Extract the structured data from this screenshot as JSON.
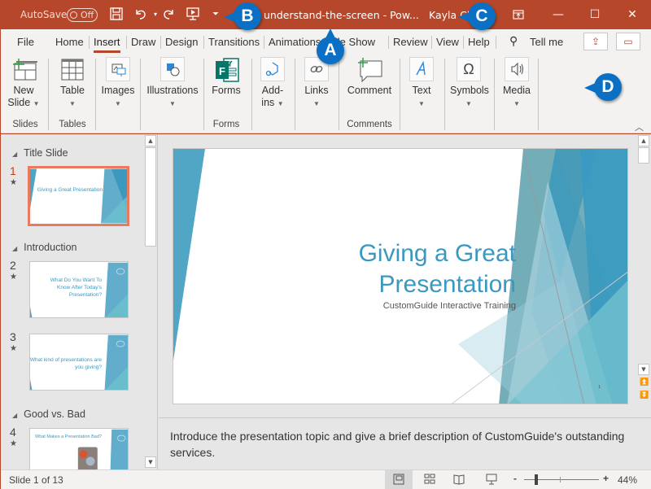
{
  "titlebar": {
    "autosave_label": "AutoSave",
    "autosave_state": "Off",
    "doc_title": "understand-the-screen  -  Pow...",
    "user": "Kayla Cla",
    "quick_access": [
      "save-icon",
      "undo-icon",
      "redo-icon",
      "start-from-beginning-icon",
      "customize-qat-icon"
    ],
    "window_controls": [
      "ribbon-display-options-icon",
      "minimize-icon",
      "maximize-icon",
      "close-icon"
    ]
  },
  "tabs": {
    "items": [
      "File",
      "Home",
      "Insert",
      "Draw",
      "Design",
      "Transitions",
      "Animations",
      "Slide Show",
      "Review",
      "View",
      "Help"
    ],
    "active": "Insert",
    "tell_me": "Tell me",
    "share_icon": "share-icon",
    "comments_icon": "comments-icon"
  },
  "ribbon": {
    "buttons": {
      "new_slide": "New Slide",
      "new_slide_l1": "New",
      "new_slide_l2": "Slide",
      "table": "Table",
      "images": "Images",
      "illustrations": "Illustrations",
      "forms": "Forms",
      "addins_l1": "Add-",
      "addins_l2": "ins",
      "links": "Links",
      "comment": "Comment",
      "text": "Text",
      "symbols": "Symbols",
      "media": "Media"
    },
    "groups": {
      "slides": "Slides",
      "tables": "Tables",
      "forms": "Forms",
      "comments": "Comments"
    }
  },
  "slide_panel": {
    "sections": [
      {
        "name": "Title Slide",
        "slides": [
          {
            "number": "1",
            "title": "Giving a Great Presentation",
            "subtitle": "CustomGuide Interactive Training",
            "selected": true
          }
        ]
      },
      {
        "name": "Introduction",
        "slides": [
          {
            "number": "2",
            "title": "What Do You Want To Know After Today's Presentation?"
          },
          {
            "number": "3",
            "title": "What kind of presentations are you giving?"
          }
        ]
      },
      {
        "name": "Good vs. Bad",
        "slides": [
          {
            "number": "4",
            "title": "What Makes a Presentation Bad?"
          }
        ]
      }
    ]
  },
  "slide": {
    "title_line1": "Giving a Great",
    "title_line2": "Presentation",
    "subtitle": "CustomGuide Interactive Training",
    "page_number": "1",
    "accent": "#3b98bf"
  },
  "notes": {
    "text": "Introduce the presentation topic and give a brief description of CustomGuide's outstanding services."
  },
  "status": {
    "slide_indicator": "Slide 1 of 13",
    "zoom": "44%",
    "zoom_minus": "-",
    "zoom_plus": "+",
    "views": [
      "normal-view-icon",
      "slide-sorter-icon",
      "reading-view-icon",
      "slide-show-icon"
    ]
  },
  "callouts": {
    "a": "A",
    "b": "B",
    "c": "C",
    "d": "D"
  },
  "colors": {
    "brand": "#b7472a",
    "callout": "#0b6fc4",
    "selection": "#e97a5e"
  }
}
